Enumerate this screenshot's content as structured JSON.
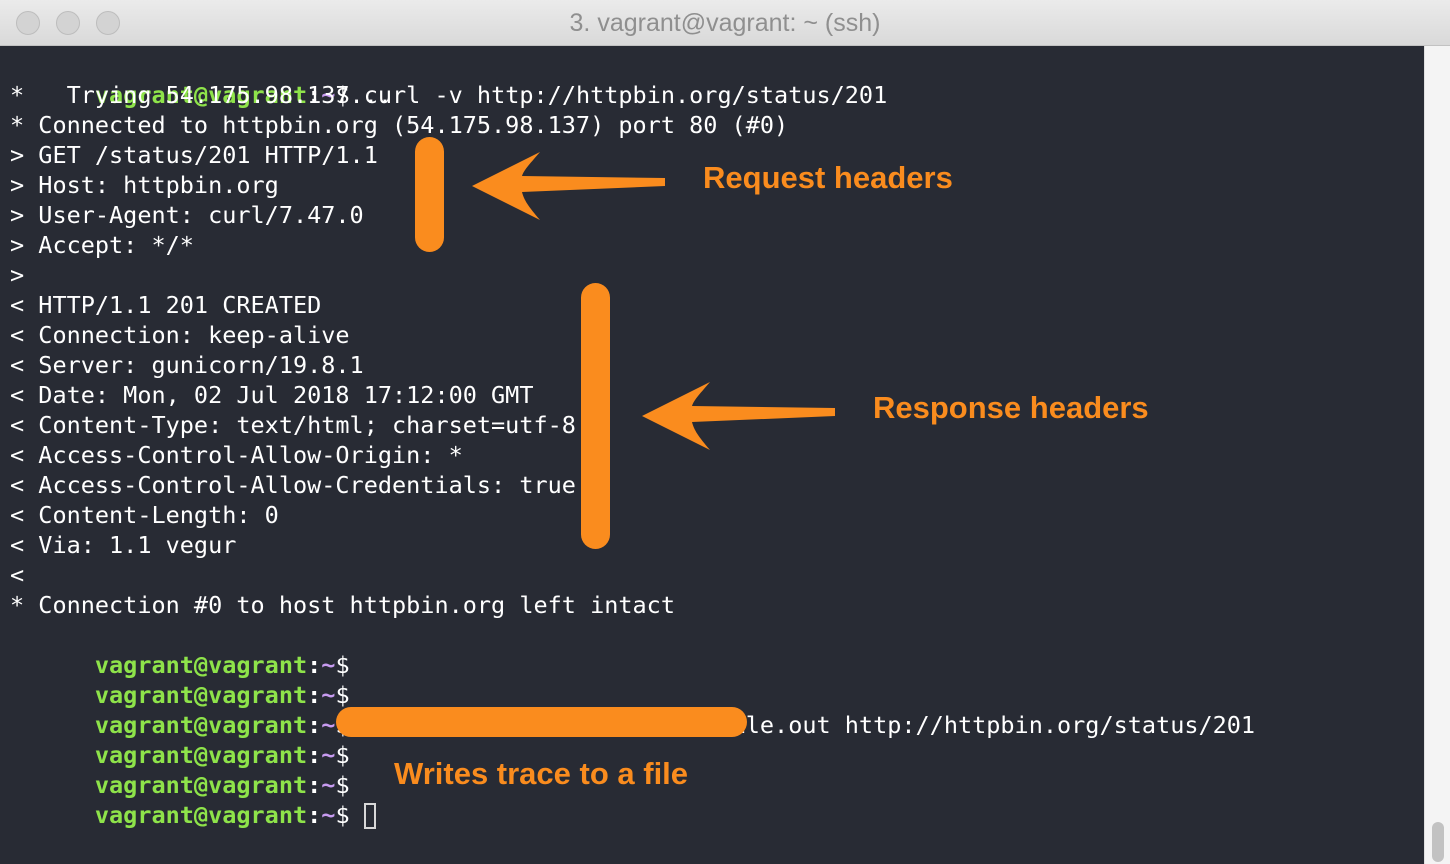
{
  "window": {
    "title": "3. vagrant@vagrant: ~ (ssh)"
  },
  "prompt": {
    "user": "vagrant@vagrant",
    "sep": ":",
    "path": "~",
    "symbol": "$"
  },
  "commands": {
    "curl_verbose": " curl -v http://httpbin.org/status/201",
    "curl_trace": " curl --trace-ascii trace-file.out http://httpbin.org/status/201"
  },
  "output": [
    "*   Trying 54.175.98.137...",
    "* Connected to httpbin.org (54.175.98.137) port 80 (#0)",
    "> GET /status/201 HTTP/1.1",
    "> Host: httpbin.org",
    "> User-Agent: curl/7.47.0",
    "> Accept: */*",
    ">",
    "< HTTP/1.1 201 CREATED",
    "< Connection: keep-alive",
    "< Server: gunicorn/19.8.1",
    "< Date: Mon, 02 Jul 2018 17:12:00 GMT",
    "< Content-Type: text/html; charset=utf-8",
    "< Access-Control-Allow-Origin: *",
    "< Access-Control-Allow-Credentials: true",
    "< Content-Length: 0",
    "< Via: 1.1 vegur",
    "<",
    "* Connection #0 to host httpbin.org left intact"
  ],
  "annotations": {
    "request": "Request headers",
    "response": "Response headers",
    "trace": "Writes trace to a file"
  },
  "colors": {
    "terminal_bg": "#282b34",
    "prompt_user": "#8ee34a",
    "prompt_path": "#c79bf0",
    "text": "#ffffff",
    "annotation": "#fa8c1e"
  }
}
